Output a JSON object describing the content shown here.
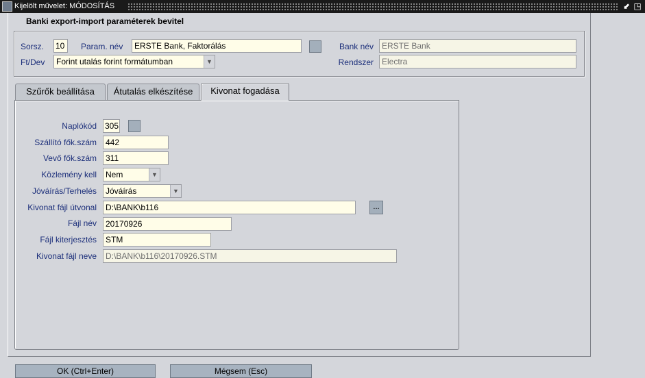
{
  "window": {
    "title": "Kijelölt művelet: MÓDOSÍTÁS",
    "btn_restore": "⬋",
    "btn_maximize": "◳"
  },
  "header": {
    "frame_title": "Banki export-import paraméterek bevitel",
    "sorsz_label": "Sorsz.",
    "sorsz_value": "10",
    "param_nev_label": "Param. név",
    "param_nev_value": "ERSTE Bank, Faktorálás",
    "bank_nev_label": "Bank név",
    "bank_nev_value": "ERSTE Bank",
    "ftdev_label": "Ft/Dev",
    "ftdev_value": "Forint utalás forint formátumban",
    "rendszer_label": "Rendszer",
    "rendszer_value": "Electra"
  },
  "tabs": [
    {
      "label": "Szűrők beállítása",
      "active": false
    },
    {
      "label": "Átutalás elkészítése",
      "active": false
    },
    {
      "label": "Kivonat fogadása",
      "active": true
    }
  ],
  "form": {
    "naplokod_label": "Naplókód",
    "naplokod_value": "305",
    "szallito_label": "Szállító fők.szám",
    "szallito_value": "442",
    "vevo_label": "Vevő fők.szám",
    "vevo_value": "311",
    "kozlemeny_label": "Közlemény kell",
    "kozlemeny_value": "Nem",
    "jovairas_label": "Jóváírás/Terhelés",
    "jovairas_value": "Jóváírás",
    "utvonal_label": "Kivonat fájl útvonal",
    "utvonal_value": "D:\\BANK\\b116",
    "browse_label": "...",
    "fajlnev_label": "Fájl név",
    "fajlnev_value": "20170926",
    "kiterjesztes_label": "Fájl kiterjesztés",
    "kiterjesztes_value": "STM",
    "kivonat_neve_label": "Kivonat fájl neve",
    "kivonat_neve_value": "D:\\BANK\\b116\\20170926.STM"
  },
  "buttons": {
    "ok_label": "OK (Ctrl+Enter)",
    "cancel_label": "Mégsem (Esc)"
  },
  "colors": {
    "label_blue": "#1b2e7a",
    "field_bg": "#fffde8",
    "window_bg": "#d4d6db",
    "button_bg": "#a7b3c0"
  }
}
